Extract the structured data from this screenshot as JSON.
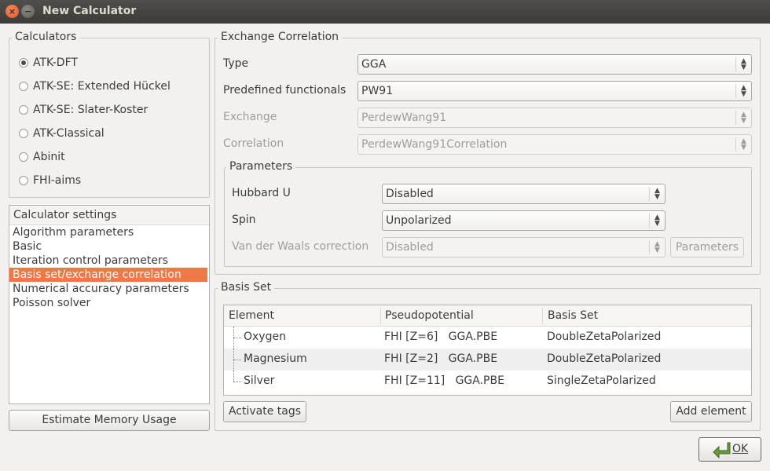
{
  "window": {
    "title": "New Calculator",
    "close_glyph": "×",
    "min_glyph": "−"
  },
  "calculators": {
    "title": "Calculators",
    "options": [
      {
        "label": "ATK-DFT",
        "checked": true
      },
      {
        "label": "ATK-SE: Extended Hückel",
        "checked": false
      },
      {
        "label": "ATK-SE: Slater-Koster",
        "checked": false
      },
      {
        "label": "ATK-Classical",
        "checked": false
      },
      {
        "label": "Abinit",
        "checked": false
      },
      {
        "label": "FHI-aims",
        "checked": false
      }
    ]
  },
  "settings": {
    "header": "Calculator settings",
    "items": [
      "Algorithm parameters",
      "Basic",
      "Iteration control parameters",
      "Basis set/exchange correlation",
      "Numerical accuracy parameters",
      "Poisson solver"
    ],
    "selected_index": 3
  },
  "estimate_button": "Estimate Memory Usage",
  "exchange": {
    "title": "Exchange Correlation",
    "type_label": "Type",
    "type_value": "GGA",
    "predefined_label": "Predefined functionals",
    "predefined_value": "PW91",
    "exchange_label": "Exchange",
    "exchange_value": "PerdewWang91",
    "correlation_label": "Correlation",
    "correlation_value": "PerdewWang91Correlation"
  },
  "parameters": {
    "title": "Parameters",
    "hubbard_label": "Hubbard U",
    "hubbard_value": "Disabled",
    "spin_label": "Spin",
    "spin_value": "Unpolarized",
    "vdw_label": "Van der Waals correction",
    "vdw_value": "Disabled",
    "vdw_button": "Parameters"
  },
  "basis_set": {
    "title": "Basis Set",
    "columns": [
      "Element",
      "Pseudopotential",
      "Basis Set"
    ],
    "rows": [
      {
        "element": "Oxygen",
        "pseudo": "FHI [Z=6]   GGA.PBE",
        "basis": "DoubleZetaPolarized"
      },
      {
        "element": "Magnesium",
        "pseudo": "FHI [Z=2]   GGA.PBE",
        "basis": "DoubleZetaPolarized"
      },
      {
        "element": "Silver",
        "pseudo": "FHI [Z=11]   GGA.PBE",
        "basis": "SingleZetaPolarized"
      }
    ],
    "activate_button": "Activate tags",
    "add_button": "Add element"
  },
  "ok_button": "OK",
  "colors": {
    "selection": "#f07746",
    "titlebar": "#3d3c38",
    "close": "#e0552b",
    "ok_icon": "#5a8a2c"
  }
}
